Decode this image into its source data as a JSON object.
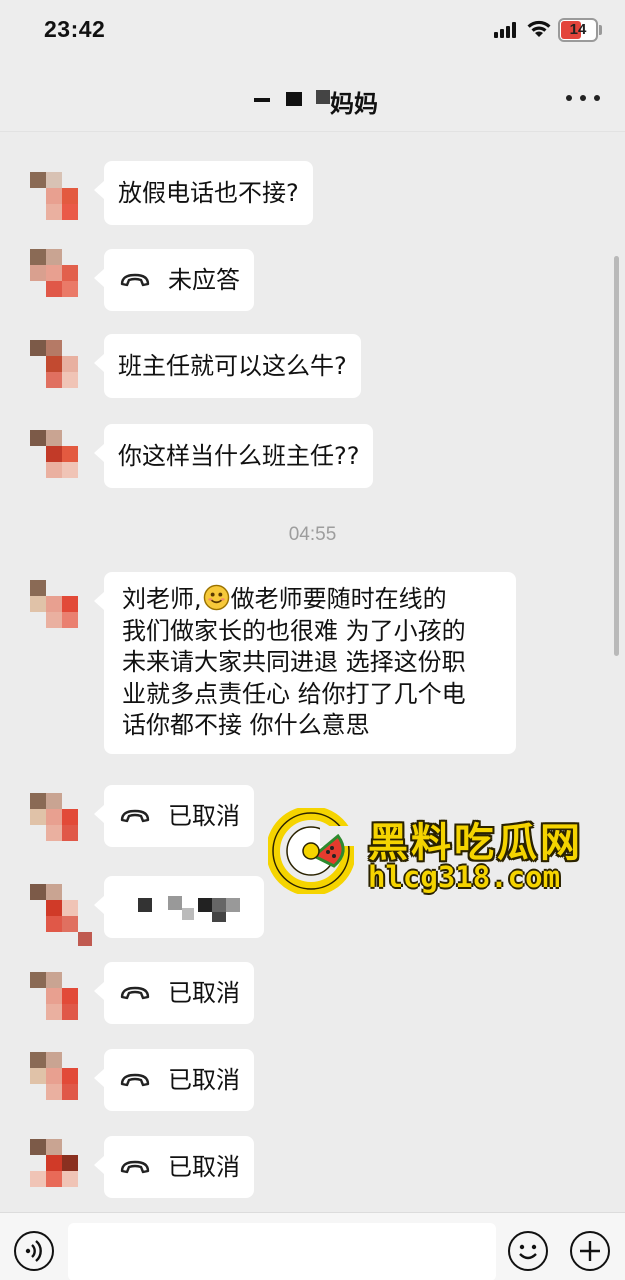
{
  "status_bar": {
    "time": "23:42",
    "battery_level": "14",
    "battery_color": "#e3443b"
  },
  "header": {
    "title": "妈妈",
    "title_prefix_redacted": true,
    "more_icon": "more-dots-icon"
  },
  "messages": [
    {
      "type": "text",
      "text": "放假电话也不接?"
    },
    {
      "type": "call",
      "icon": "phone-icon",
      "text": "未应答"
    },
    {
      "type": "text",
      "text": "班主任就可以这么牛?"
    },
    {
      "type": "text",
      "text": "你这样当什么班主任??"
    },
    {
      "type": "time",
      "text": "04:55"
    },
    {
      "type": "text",
      "lines": [
        {
          "before": "刘老师,",
          "emoji": "smiling-emoji",
          "after": "做老师要随时在线的"
        },
        {
          "text": "我们做家长的也很难 为了小孩的"
        },
        {
          "text": "未来请大家共同进退 选择这份职"
        },
        {
          "text": "业就多点责任心 给你打了几个电"
        },
        {
          "text": "话你都不接 你什么意思"
        }
      ]
    },
    {
      "type": "call",
      "icon": "phone-icon",
      "text": "已取消"
    },
    {
      "type": "redacted",
      "note": "pixelated"
    },
    {
      "type": "call",
      "icon": "phone-icon",
      "text": "已取消"
    },
    {
      "type": "call",
      "icon": "phone-icon",
      "text": "已取消"
    },
    {
      "type": "call",
      "icon": "phone-icon",
      "text": "已取消"
    }
  ],
  "watermark": {
    "name": "黑料吃瓜网",
    "url": "hlcg318.com",
    "color": "#f5d400"
  },
  "input_bar": {
    "voice_icon": "voice-icon",
    "input_value": "",
    "emoji_icon": "emoji-icon",
    "plus_icon": "plus-icon"
  }
}
